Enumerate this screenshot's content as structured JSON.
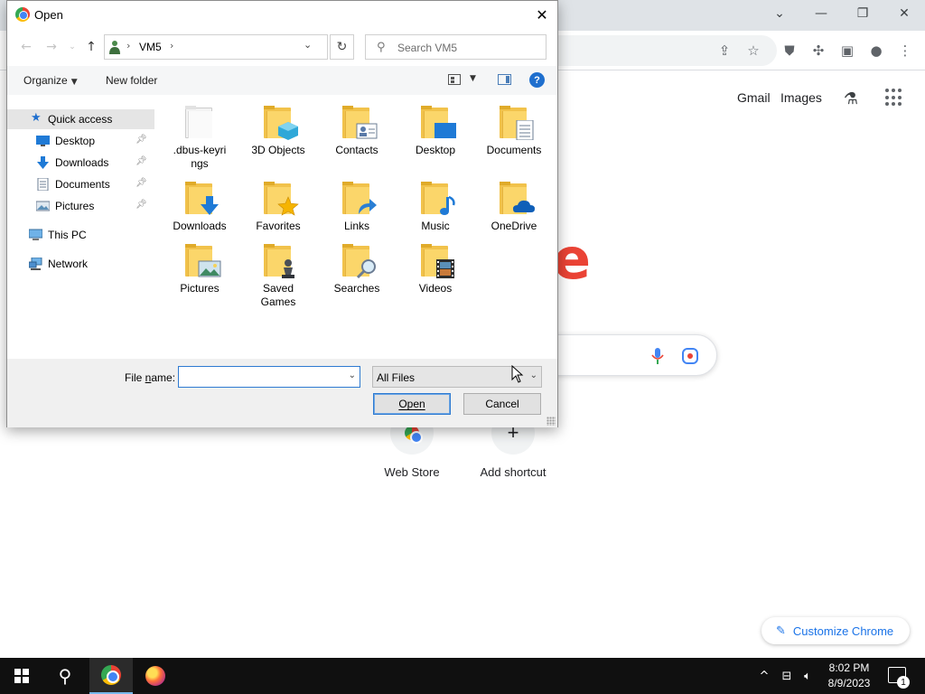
{
  "browser": {
    "header_links": [
      "Gmail",
      "Images"
    ],
    "shortcuts": [
      {
        "label": "Web Store"
      },
      {
        "label": "Add shortcut"
      }
    ],
    "customize_label": "Customize Chrome"
  },
  "dialog": {
    "title": "Open",
    "address": {
      "crumb": "VM5"
    },
    "search_placeholder": "Search VM5",
    "toolbar": {
      "organize": "Organize",
      "new_folder": "New folder",
      "help": "?"
    },
    "nav_pane": {
      "quick_access": "Quick access",
      "pinned": [
        {
          "label": "Desktop",
          "icon": "desktop-icon"
        },
        {
          "label": "Downloads",
          "icon": "download-arrow-icon"
        },
        {
          "label": "Documents",
          "icon": "document-icon"
        },
        {
          "label": "Pictures",
          "icon": "picture-icon"
        }
      ],
      "this_pc": "This PC",
      "network": "Network"
    },
    "items": [
      {
        "label": ".dbus-keyri\nngs",
        "icon": "folder-plain-icon"
      },
      {
        "label": "3D Objects",
        "icon": "folder-3d-objects-icon"
      },
      {
        "label": "Contacts",
        "icon": "folder-contacts-icon"
      },
      {
        "label": "Desktop",
        "icon": "folder-desktop-icon"
      },
      {
        "label": "Documents",
        "icon": "folder-documents-icon"
      },
      {
        "label": "Downloads",
        "icon": "folder-downloads-icon"
      },
      {
        "label": "Favorites",
        "icon": "folder-favorites-icon"
      },
      {
        "label": "Links",
        "icon": "folder-links-icon"
      },
      {
        "label": "Music",
        "icon": "folder-music-icon"
      },
      {
        "label": "OneDrive",
        "icon": "folder-onedrive-icon"
      },
      {
        "label": "Pictures",
        "icon": "folder-pictures-icon"
      },
      {
        "label": "Saved\nGames",
        "icon": "folder-saved-games-icon"
      },
      {
        "label": "Searches",
        "icon": "folder-searches-icon"
      },
      {
        "label": "Videos",
        "icon": "folder-videos-icon"
      }
    ],
    "file_name_label": "File name:",
    "file_name_value": "",
    "filter_value": "All Files",
    "open_button": "Open",
    "cancel_button": "Cancel"
  },
  "taskbar": {
    "time": "8:02 PM",
    "date": "8/9/2023",
    "notification_count": "1"
  },
  "colors": {
    "folder": "#fbd66a",
    "accent": "#2e7ad1",
    "google_red": "#ea4335",
    "customize_blue": "#1a73e8"
  }
}
